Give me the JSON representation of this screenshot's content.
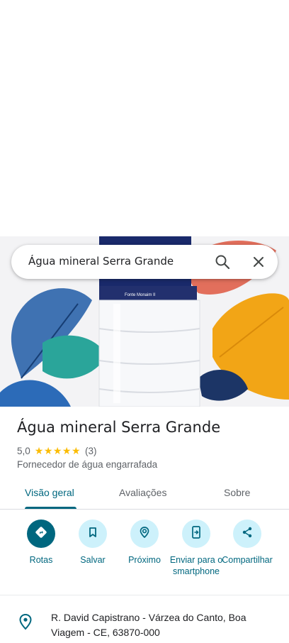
{
  "search": {
    "query": "Água mineral Serra Grande"
  },
  "hero": {
    "bottle_label": "Fonte Monaim II"
  },
  "place": {
    "title": "Água mineral Serra Grande",
    "rating": "5,0",
    "stars": "★★★★★",
    "review_count": "(3)",
    "category": "Fornecedor de água engarrafada"
  },
  "tabs": [
    {
      "label": "Visão geral",
      "active": true
    },
    {
      "label": "Avaliações",
      "active": false
    },
    {
      "label": "Sobre",
      "active": false
    }
  ],
  "actions": [
    {
      "label": "Rotas",
      "icon": "directions-icon"
    },
    {
      "label": "Salvar",
      "icon": "bookmark-icon"
    },
    {
      "label": "Próximo",
      "icon": "nearby-icon"
    },
    {
      "label": "Enviar para o smartphone",
      "icon": "send-to-phone-icon"
    },
    {
      "label": "Compartilhar",
      "icon": "share-icon"
    }
  ],
  "address": {
    "text": "R. David Capistrano - Várzea do Canto, Boa Viagem - CE, 63870-000"
  },
  "colors": {
    "accent": "#00677f",
    "action_bg": "#cdf1fb",
    "star": "#fbbc04"
  }
}
